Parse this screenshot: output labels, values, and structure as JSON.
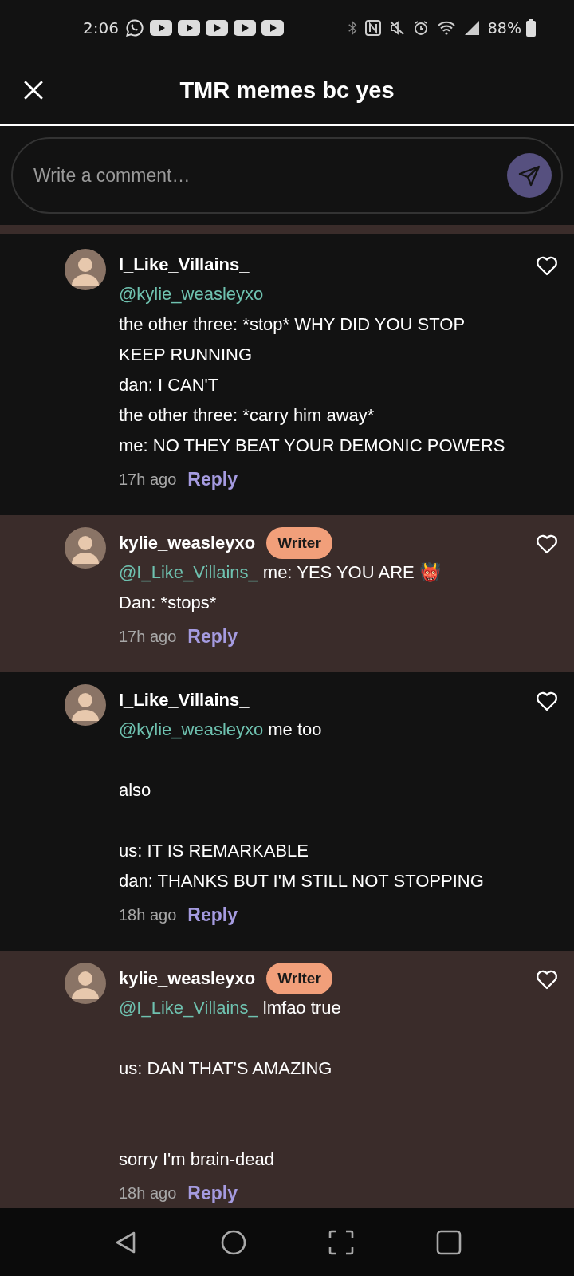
{
  "status_bar": {
    "time": "2:06",
    "battery": "88%"
  },
  "header": {
    "title": "TMR memes bc yes"
  },
  "composer": {
    "placeholder": "Write a comment…"
  },
  "comments": [
    {
      "username": "I_Like_Villains_",
      "liked": false,
      "mention": "@kylie_weasleyxo",
      "kind": "mention_alone",
      "time": "17h ago",
      "reply": "Reply",
      "highlighted": false,
      "paragraphs": [
        {
          "lines": [
            "the other three: *stop* WHY DID YOU STOP",
            "KEEP RUNNING",
            "dan: I CAN'T",
            "the other three: *carry him away*",
            "me: NO THEY BEAT YOUR DEMONIC POWERS"
          ]
        }
      ]
    },
    {
      "username": "kylie_weasleyxo",
      "badge": "Writer",
      "liked": false,
      "mention": "@I_Like_Villains_",
      "kind": "mention_inline",
      "time": "17h ago",
      "reply": "Reply",
      "highlighted": true,
      "paragraphs": [
        {
          "lines": [
            "me: YES YOU ARE 👹",
            "Dan: *stops*"
          ]
        }
      ]
    },
    {
      "username": "I_Like_Villains_",
      "liked": false,
      "mention": "@kylie_weasleyxo",
      "kind": "mention_inline",
      "time": "18h ago",
      "reply": "Reply",
      "highlighted": false,
      "paragraphs": [
        {
          "lines": [
            "me too"
          ]
        },
        {
          "kind": "after_blank",
          "lines": [
            "also"
          ]
        },
        {
          "kind": "after_blank",
          "lines": [
            "us: IT IS REMARKABLE",
            "dan: THANKS BUT I'M STILL NOT STOPPING"
          ]
        }
      ]
    },
    {
      "username": "kylie_weasleyxo",
      "badge": "Writer",
      "liked": false,
      "mention": "@I_Like_Villains_",
      "kind": "mention_inline",
      "time": "18h ago",
      "reply": "Reply",
      "highlighted": true,
      "paragraphs": [
        {
          "lines": [
            "lmfao true"
          ]
        },
        {
          "kind": "after_blank",
          "lines": [
            "us: DAN THAT'S AMAZING"
          ]
        },
        {
          "kind": "after_two_blanks",
          "lines": [
            "sorry I'm brain-dead"
          ]
        }
      ]
    }
  ]
}
